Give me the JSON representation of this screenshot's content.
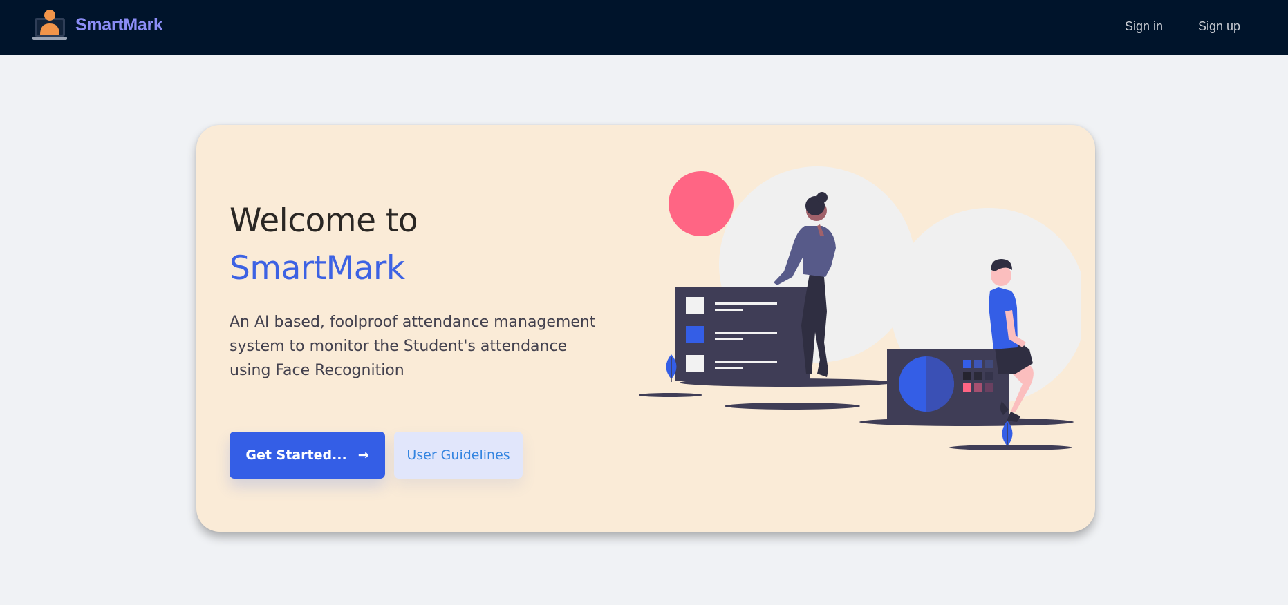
{
  "navbar": {
    "brand_name": "SmartMark",
    "sign_in": "Sign in",
    "sign_up": "Sign up"
  },
  "hero": {
    "title_line1": "Welcome to",
    "title_line2": "SmartMark",
    "description": "An AI based, foolproof attendance management system to monitor the Student's attendance using Face Recognition",
    "primary_button": "Get Started...",
    "primary_button_icon": "arrow-right-icon",
    "secondary_button": "User Guidelines"
  },
  "colors": {
    "navbar_bg": "#00142b",
    "brand": "#8b8df6",
    "accent": "#3d62e3",
    "card_bg": "#faebd7",
    "page_bg": "#f0f2f5",
    "primary_button": "#345ee6",
    "secondary_button_bg": "#e1e6fb",
    "secondary_button_text": "#3384e0"
  }
}
